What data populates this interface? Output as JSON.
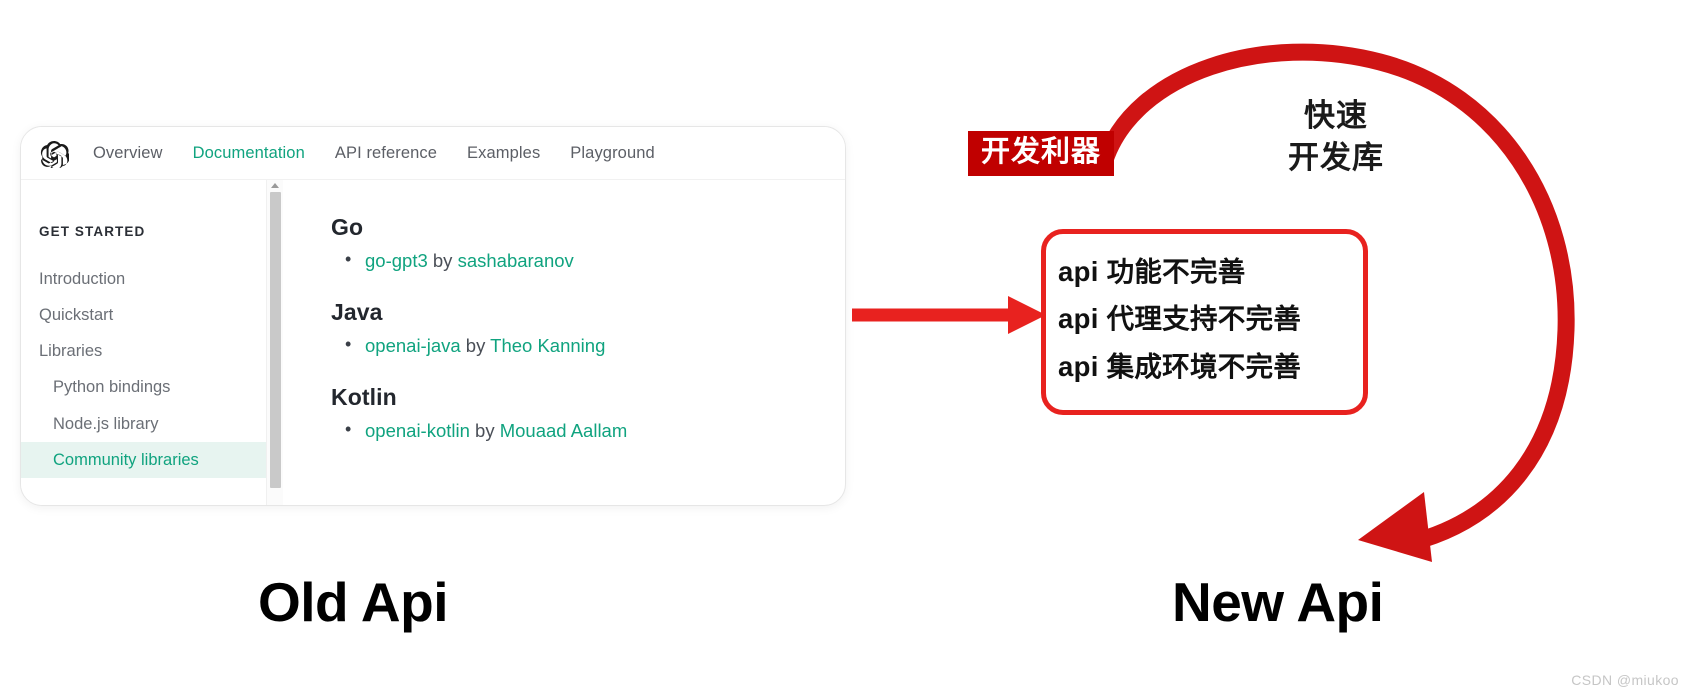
{
  "docs_card": {
    "logo_icon": "openai-logo-icon",
    "nav": [
      {
        "label": "Overview",
        "active": false
      },
      {
        "label": "Documentation",
        "active": true
      },
      {
        "label": "API reference",
        "active": false
      },
      {
        "label": "Examples",
        "active": false
      },
      {
        "label": "Playground",
        "active": false
      }
    ],
    "sidebar": {
      "heading": "GET STARTED",
      "items": [
        {
          "label": "Introduction",
          "sub": false,
          "selected": false
        },
        {
          "label": "Quickstart",
          "sub": false,
          "selected": false
        },
        {
          "label": "Libraries",
          "sub": false,
          "selected": false
        },
        {
          "label": "Python bindings",
          "sub": true,
          "selected": false
        },
        {
          "label": "Node.js library",
          "sub": true,
          "selected": false
        },
        {
          "label": "Community libraries",
          "sub": true,
          "selected": true
        }
      ]
    },
    "sections": [
      {
        "heading": "Go",
        "items": [
          {
            "name": "go-gpt3",
            "by": "by",
            "author": "sashabaranov"
          }
        ]
      },
      {
        "heading": "Java",
        "items": [
          {
            "name": "openai-java",
            "by": "by",
            "author": "Theo Kanning"
          }
        ]
      },
      {
        "heading": "Kotlin",
        "items": [
          {
            "name": "openai-kotlin",
            "by": "by",
            "author": "Mouaad Aallam"
          }
        ]
      }
    ]
  },
  "annotations": {
    "dev_badge": "开发利器",
    "cycle_label_line1": "快速",
    "cycle_label_line2": "开发库",
    "api_issues": [
      "api 功能不完善",
      "api 代理支持不完善",
      "api 集成环境不完善"
    ],
    "caption_left": "Old Api",
    "caption_right": "New Api"
  },
  "watermark": "CSDN @miukoo",
  "colors": {
    "accent_green": "#10a37f",
    "badge_red": "#c00000",
    "arrow_red": "#cf1414",
    "box_red": "#e8221f",
    "sidebar_selected_bg": "#e7f4f0"
  }
}
